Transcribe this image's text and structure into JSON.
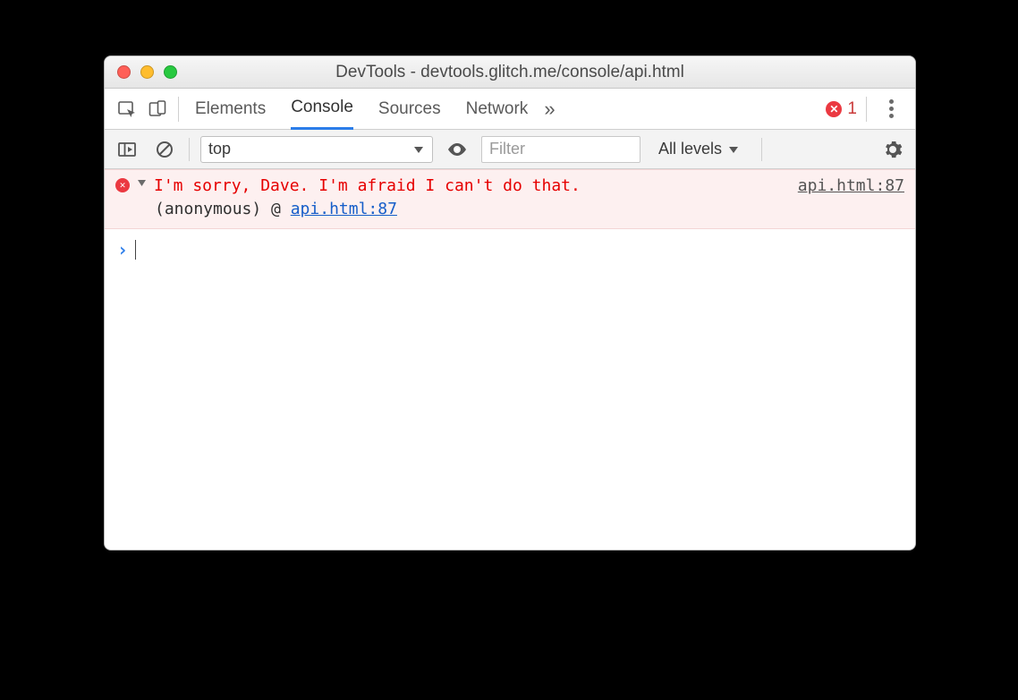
{
  "window": {
    "title": "DevTools - devtools.glitch.me/console/api.html"
  },
  "tabs": {
    "items": [
      "Elements",
      "Console",
      "Sources",
      "Network"
    ],
    "active_index": 1,
    "overflow_glyph": "»"
  },
  "error_indicator": {
    "count": "1"
  },
  "filterbar": {
    "context_label": "top",
    "filter_placeholder": "Filter",
    "levels_label": "All levels"
  },
  "console": {
    "error": {
      "message": "I'm sorry, Dave. I'm afraid I can't do that.",
      "source_link": "api.html:87",
      "stack_prefix": "(anonymous) @ ",
      "stack_link": "api.html:87"
    }
  }
}
